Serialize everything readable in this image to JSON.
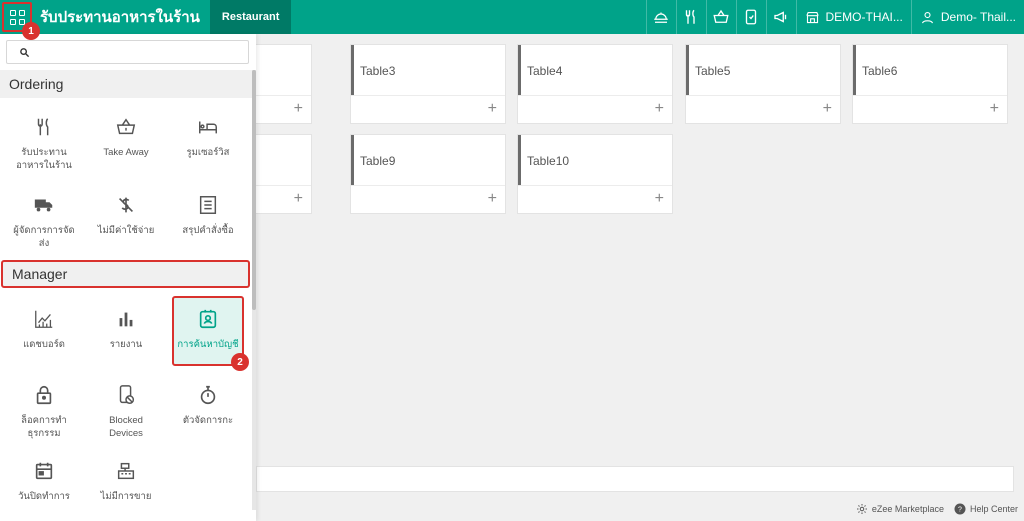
{
  "header": {
    "title": "รับประทานอาหารในร้าน",
    "tab_label": "Restaurant",
    "location": "DEMO-THAI...",
    "user": "Demo- Thail..."
  },
  "badges": {
    "first": "1",
    "second": "2"
  },
  "tables": [
    "Table3",
    "Table4",
    "Table5",
    "Table6",
    "Table9",
    "Table10"
  ],
  "side_menu": {
    "ordering_title": "Ordering",
    "manager_title": "Manager",
    "ordering_items": [
      {
        "label": "รับประทาน\nอาหารในร้าน",
        "icon": "fork-knife-icon"
      },
      {
        "label": "Take Away",
        "icon": "basket-icon"
      },
      {
        "label": "รูมเซอร์วิส",
        "icon": "bed-icon"
      },
      {
        "label": "ผู้จัดการการจัด\nส่ง",
        "icon": "truck-icon"
      },
      {
        "label": "ไม่มีค่าใช้จ่าย",
        "icon": "no-dollar-icon"
      },
      {
        "label": "สรุปคำสั่งซื้อ",
        "icon": "receipt-icon"
      }
    ],
    "manager_items": [
      {
        "label": "แดชบอร์ด",
        "icon": "line-chart-icon"
      },
      {
        "label": "รายงาน",
        "icon": "bar-chart-icon"
      },
      {
        "label": "การค้นหาบัญชี",
        "icon": "account-card-icon"
      },
      {
        "label": "ล็อคการทำ\nธุรกรรม",
        "icon": "lock-icon"
      },
      {
        "label": "Blocked\nDevices",
        "icon": "blocked-device-icon"
      },
      {
        "label": "ตัวจัดการกะ",
        "icon": "stopwatch-icon"
      },
      {
        "label": "วันปิดทำการ",
        "icon": "calendar-icon"
      },
      {
        "label": "ไม่มีการขาย",
        "icon": "cash-register-icon"
      }
    ]
  },
  "footer": {
    "marketplace": "eZee Marketplace",
    "help": "Help Center"
  },
  "colors": {
    "brand": "#00a389",
    "highlight": "#d9322e"
  }
}
